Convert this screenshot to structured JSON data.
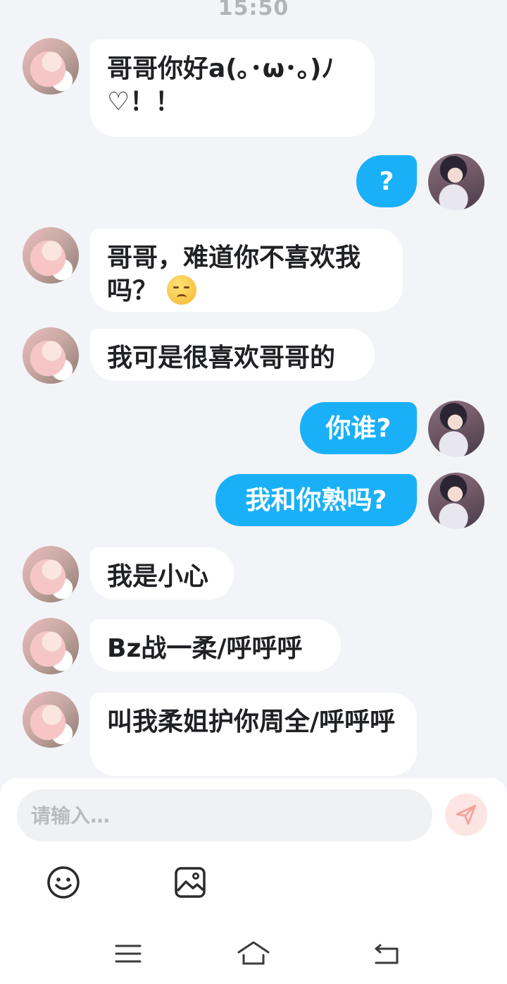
{
  "status": {
    "time": "15:50"
  },
  "messages": [
    {
      "side": "in",
      "text": "哥哥你好a(｡･ω･｡)ﾉ♡！！"
    },
    {
      "side": "out",
      "text": "?"
    },
    {
      "side": "in",
      "text": "哥哥，难道你不喜欢我吗？",
      "emoji": "pensive-emoji"
    },
    {
      "side": "in",
      "text": "我可是很喜欢哥哥的"
    },
    {
      "side": "out",
      "text": "你谁?"
    },
    {
      "side": "out",
      "text": "我和你熟吗?"
    },
    {
      "side": "in",
      "text": "我是小心"
    },
    {
      "side": "in",
      "text": "Bz战一柔/呼呼呼"
    },
    {
      "side": "in",
      "text": "叫我柔姐护你周全/呼呼呼"
    }
  ],
  "composer": {
    "placeholder": "请输入…",
    "send_icon": "send-icon",
    "tools": [
      "emoji-icon",
      "image-icon"
    ]
  },
  "navbar": {
    "icons": [
      "menu-icon",
      "home-icon",
      "back-icon"
    ]
  },
  "colors": {
    "outgoing": "#1ab0f8",
    "incoming": "#ffffff",
    "background": "#f3f4f7",
    "send_button": "#fde5e3"
  }
}
